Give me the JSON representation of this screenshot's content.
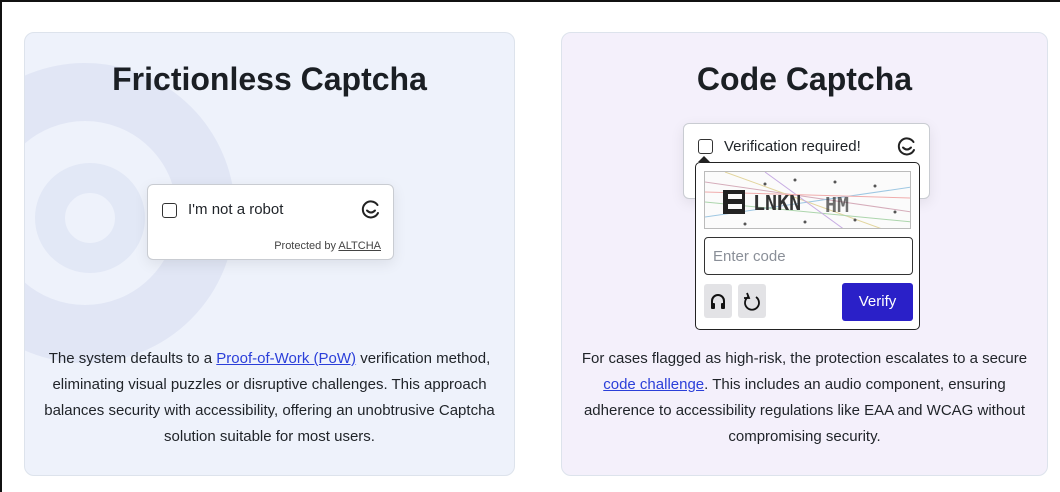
{
  "frictionless": {
    "title": "Frictionless Captcha",
    "checkbox_label": "I'm not a robot",
    "protected_prefix": "Protected by ",
    "protected_link": "ALTCHA",
    "desc_1": "The system defaults to a ",
    "desc_link": "Proof-of-Work (PoW)",
    "desc_2": " verification method, eliminating visual puzzles or disruptive challenges. This approach balances security with accessibility, offering an unobtrusive Captcha solution suitable for most users.",
    "logo_icon": "altcha-icon"
  },
  "code": {
    "title": "Code Captcha",
    "checkbox_label": "Verification required!",
    "input_placeholder": "Enter code",
    "verify_label": "Verify",
    "audio_icon": "headphones-icon",
    "reload_icon": "reload-icon",
    "desc_1": "For cases flagged as high-risk, the protection escalates to a secure ",
    "desc_link": "code challenge",
    "desc_2": ". This includes an audio component, ensuring adherence to accessibility regulations like EAA and WCAG without compromising security.",
    "captcha_image": "distorted-code-image"
  },
  "colors": {
    "left_card_bg": "#eef2fb",
    "right_card_bg": "#f4f0fb",
    "verify_bg": "#2a20c8",
    "link": "#2b3fd9"
  }
}
